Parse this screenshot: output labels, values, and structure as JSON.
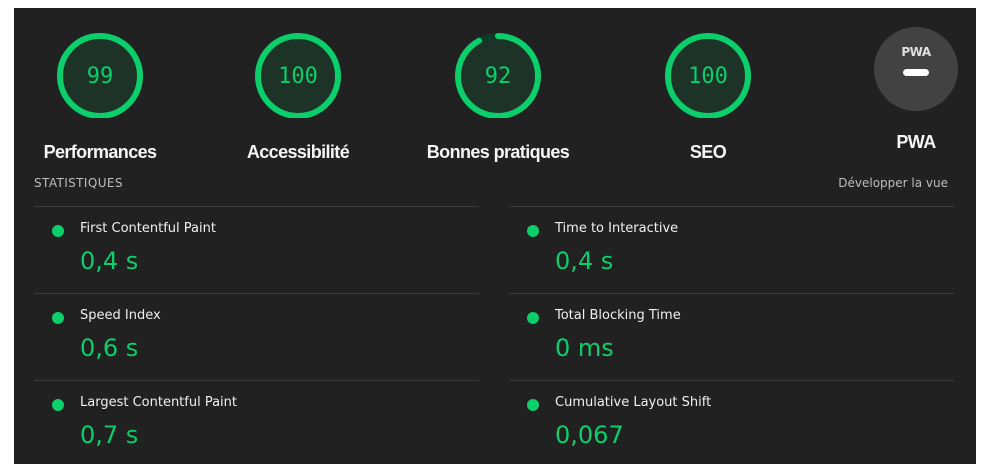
{
  "gauges": [
    {
      "score": "99",
      "label": "Performances",
      "color": "#0cce6b"
    },
    {
      "score": "100",
      "label": "Accessibilité",
      "color": "#0cce6b"
    },
    {
      "score": "92",
      "label": "Bonnes pratiques",
      "color": "#0cce6b"
    },
    {
      "score": "100",
      "label": "SEO",
      "color": "#0cce6b"
    }
  ],
  "pwa": {
    "badge_text": "PWA",
    "label": "PWA",
    "icon": "pwa-badge-icon"
  },
  "metrics_section": {
    "title": "STATISTIQUES",
    "toggle_label": "Développer la vue"
  },
  "metrics": [
    {
      "title": "First Contentful Paint",
      "value": "0,4 s",
      "status_color": "#0cce6b"
    },
    {
      "title": "Time to Interactive",
      "value": "0,4 s",
      "status_color": "#0cce6b"
    },
    {
      "title": "Speed Index",
      "value": "0,6 s",
      "status_color": "#0cce6b"
    },
    {
      "title": "Total Blocking Time",
      "value": "0 ms",
      "status_color": "#0cce6b"
    },
    {
      "title": "Largest Contentful Paint",
      "value": "0,7 s",
      "status_color": "#0cce6b"
    },
    {
      "title": "Cumulative Layout Shift",
      "value": "0,067",
      "status_color": "#0cce6b"
    }
  ],
  "colors": {
    "pass": "#0cce6b",
    "background": "#212121",
    "track": "#0b3d24"
  }
}
